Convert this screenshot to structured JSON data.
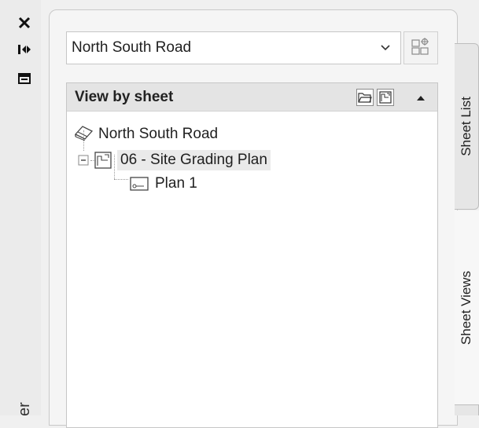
{
  "palette_strip": {
    "close_icon": "close-icon",
    "dock_icon": "auto-hide-icon",
    "properties_icon": "properties-icon",
    "title_fragment": "er"
  },
  "sheet_set_selector": {
    "selected_value": "North South Road",
    "dropdown_icon": "chevron-down-icon",
    "new_view_button_icon": "sheet-view-layout-icon"
  },
  "tree": {
    "header_title": "View by sheet",
    "header_icons": [
      "open-folder-icon",
      "sheet-icon"
    ],
    "collapse_icon": "triangle-up-icon",
    "items": [
      {
        "label": "North South Road",
        "icon": "sheet-set-icon",
        "level": 0
      },
      {
        "label": "06 - Site Grading Plan",
        "icon": "sheet-icon",
        "level": 1,
        "selected": true,
        "expander": "minus"
      },
      {
        "label": "Plan 1",
        "icon": "view-icon",
        "level": 2
      }
    ]
  },
  "side_tabs": {
    "sheet_list": "Sheet List",
    "sheet_views": "Sheet Views"
  }
}
